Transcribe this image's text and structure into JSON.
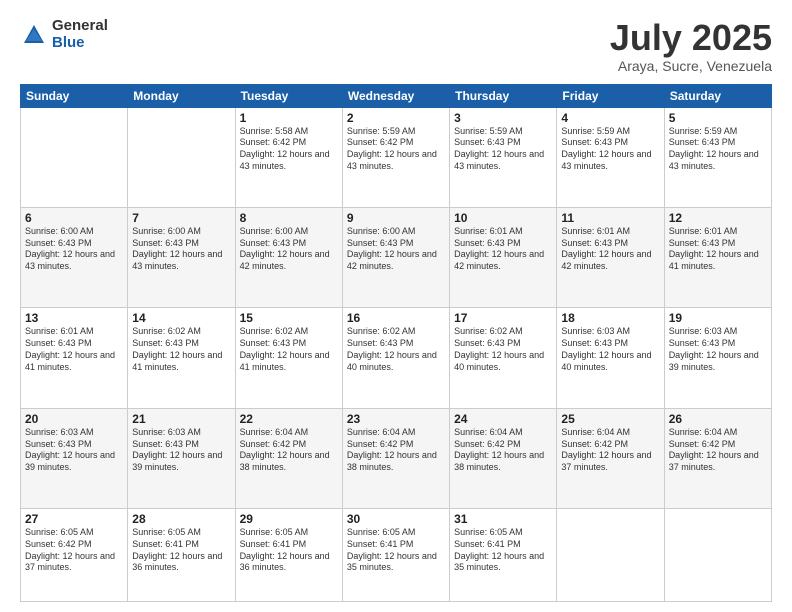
{
  "header": {
    "logo_general": "General",
    "logo_blue": "Blue",
    "month_title": "July 2025",
    "location": "Araya, Sucre, Venezuela"
  },
  "days_of_week": [
    "Sunday",
    "Monday",
    "Tuesday",
    "Wednesday",
    "Thursday",
    "Friday",
    "Saturday"
  ],
  "weeks": [
    [
      {
        "day": "",
        "info": ""
      },
      {
        "day": "",
        "info": ""
      },
      {
        "day": "1",
        "info": "Sunrise: 5:58 AM\nSunset: 6:42 PM\nDaylight: 12 hours and 43 minutes."
      },
      {
        "day": "2",
        "info": "Sunrise: 5:59 AM\nSunset: 6:42 PM\nDaylight: 12 hours and 43 minutes."
      },
      {
        "day": "3",
        "info": "Sunrise: 5:59 AM\nSunset: 6:43 PM\nDaylight: 12 hours and 43 minutes."
      },
      {
        "day": "4",
        "info": "Sunrise: 5:59 AM\nSunset: 6:43 PM\nDaylight: 12 hours and 43 minutes."
      },
      {
        "day": "5",
        "info": "Sunrise: 5:59 AM\nSunset: 6:43 PM\nDaylight: 12 hours and 43 minutes."
      }
    ],
    [
      {
        "day": "6",
        "info": "Sunrise: 6:00 AM\nSunset: 6:43 PM\nDaylight: 12 hours and 43 minutes."
      },
      {
        "day": "7",
        "info": "Sunrise: 6:00 AM\nSunset: 6:43 PM\nDaylight: 12 hours and 43 minutes."
      },
      {
        "day": "8",
        "info": "Sunrise: 6:00 AM\nSunset: 6:43 PM\nDaylight: 12 hours and 42 minutes."
      },
      {
        "day": "9",
        "info": "Sunrise: 6:00 AM\nSunset: 6:43 PM\nDaylight: 12 hours and 42 minutes."
      },
      {
        "day": "10",
        "info": "Sunrise: 6:01 AM\nSunset: 6:43 PM\nDaylight: 12 hours and 42 minutes."
      },
      {
        "day": "11",
        "info": "Sunrise: 6:01 AM\nSunset: 6:43 PM\nDaylight: 12 hours and 42 minutes."
      },
      {
        "day": "12",
        "info": "Sunrise: 6:01 AM\nSunset: 6:43 PM\nDaylight: 12 hours and 41 minutes."
      }
    ],
    [
      {
        "day": "13",
        "info": "Sunrise: 6:01 AM\nSunset: 6:43 PM\nDaylight: 12 hours and 41 minutes."
      },
      {
        "day": "14",
        "info": "Sunrise: 6:02 AM\nSunset: 6:43 PM\nDaylight: 12 hours and 41 minutes."
      },
      {
        "day": "15",
        "info": "Sunrise: 6:02 AM\nSunset: 6:43 PM\nDaylight: 12 hours and 41 minutes."
      },
      {
        "day": "16",
        "info": "Sunrise: 6:02 AM\nSunset: 6:43 PM\nDaylight: 12 hours and 40 minutes."
      },
      {
        "day": "17",
        "info": "Sunrise: 6:02 AM\nSunset: 6:43 PM\nDaylight: 12 hours and 40 minutes."
      },
      {
        "day": "18",
        "info": "Sunrise: 6:03 AM\nSunset: 6:43 PM\nDaylight: 12 hours and 40 minutes."
      },
      {
        "day": "19",
        "info": "Sunrise: 6:03 AM\nSunset: 6:43 PM\nDaylight: 12 hours and 39 minutes."
      }
    ],
    [
      {
        "day": "20",
        "info": "Sunrise: 6:03 AM\nSunset: 6:43 PM\nDaylight: 12 hours and 39 minutes."
      },
      {
        "day": "21",
        "info": "Sunrise: 6:03 AM\nSunset: 6:43 PM\nDaylight: 12 hours and 39 minutes."
      },
      {
        "day": "22",
        "info": "Sunrise: 6:04 AM\nSunset: 6:42 PM\nDaylight: 12 hours and 38 minutes."
      },
      {
        "day": "23",
        "info": "Sunrise: 6:04 AM\nSunset: 6:42 PM\nDaylight: 12 hours and 38 minutes."
      },
      {
        "day": "24",
        "info": "Sunrise: 6:04 AM\nSunset: 6:42 PM\nDaylight: 12 hours and 38 minutes."
      },
      {
        "day": "25",
        "info": "Sunrise: 6:04 AM\nSunset: 6:42 PM\nDaylight: 12 hours and 37 minutes."
      },
      {
        "day": "26",
        "info": "Sunrise: 6:04 AM\nSunset: 6:42 PM\nDaylight: 12 hours and 37 minutes."
      }
    ],
    [
      {
        "day": "27",
        "info": "Sunrise: 6:05 AM\nSunset: 6:42 PM\nDaylight: 12 hours and 37 minutes."
      },
      {
        "day": "28",
        "info": "Sunrise: 6:05 AM\nSunset: 6:41 PM\nDaylight: 12 hours and 36 minutes."
      },
      {
        "day": "29",
        "info": "Sunrise: 6:05 AM\nSunset: 6:41 PM\nDaylight: 12 hours and 36 minutes."
      },
      {
        "day": "30",
        "info": "Sunrise: 6:05 AM\nSunset: 6:41 PM\nDaylight: 12 hours and 35 minutes."
      },
      {
        "day": "31",
        "info": "Sunrise: 6:05 AM\nSunset: 6:41 PM\nDaylight: 12 hours and 35 minutes."
      },
      {
        "day": "",
        "info": ""
      },
      {
        "day": "",
        "info": ""
      }
    ]
  ]
}
